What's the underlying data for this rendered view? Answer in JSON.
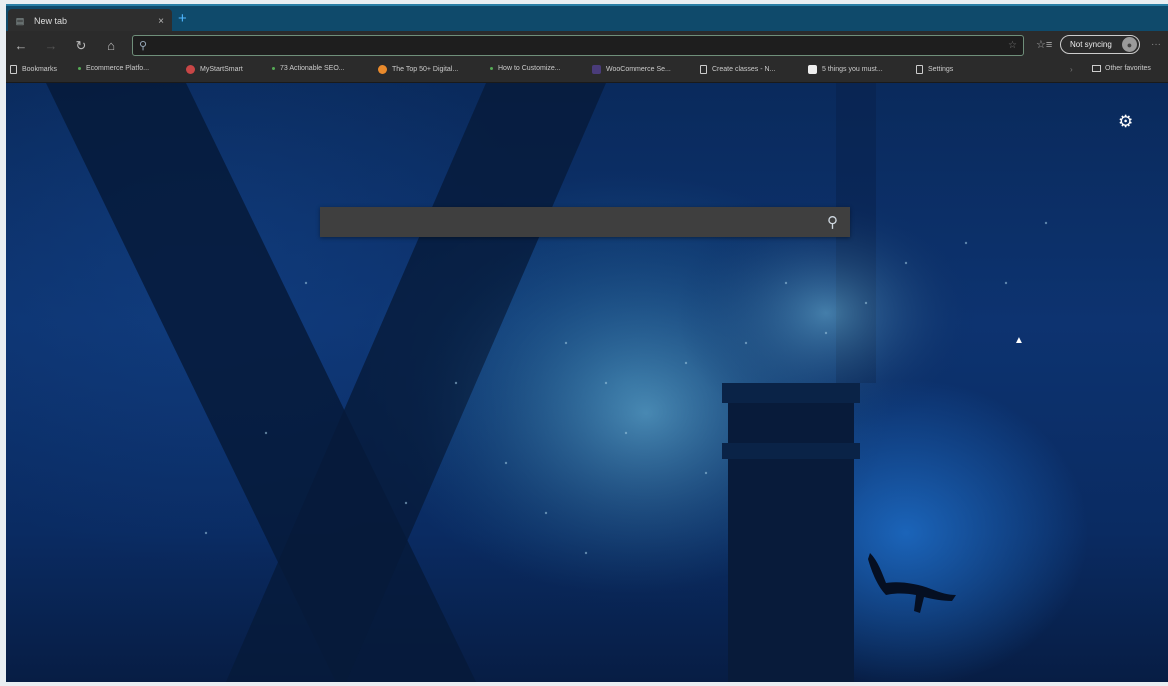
{
  "tab": {
    "favicon": "page-icon",
    "title": "New tab",
    "close": "×"
  },
  "newtab_glyph": "+",
  "toolbar": {
    "back": "←",
    "forward": "→",
    "refresh": "↻",
    "home": "⌂",
    "address_value": "",
    "favorites": "☆≡",
    "signin_label": "Not syncing",
    "menu": "···"
  },
  "bookmarks": [
    {
      "label": "Bookmarks",
      "icon": "page"
    },
    {
      "label": "Ecommerce Platfo...",
      "icon": "dot"
    },
    {
      "label": "MyStartSmart",
      "icon": "red"
    },
    {
      "label": "73 Actionable SEO...",
      "icon": "dot"
    },
    {
      "label": "The Top 50+ Digital...",
      "icon": "orange"
    },
    {
      "label": "How to Customize...",
      "icon": "dot"
    },
    {
      "label": "WooCommerce Se...",
      "icon": "purple"
    },
    {
      "label": "Create classes - N...",
      "icon": "page"
    },
    {
      "label": "5 things you must...",
      "icon": "white"
    },
    {
      "label": "Settings",
      "icon": "page"
    }
  ],
  "other_favorites": "Other favorites",
  "ntp": {
    "gear": "⚙",
    "search_value": "",
    "search_icon": "⚲"
  },
  "colors": {
    "tabstrip": "#0f4a6b",
    "toolbar": "#2b2b2b",
    "ocean_deep": "#0a2a5c",
    "ocean_light": "#1e6ec8"
  }
}
